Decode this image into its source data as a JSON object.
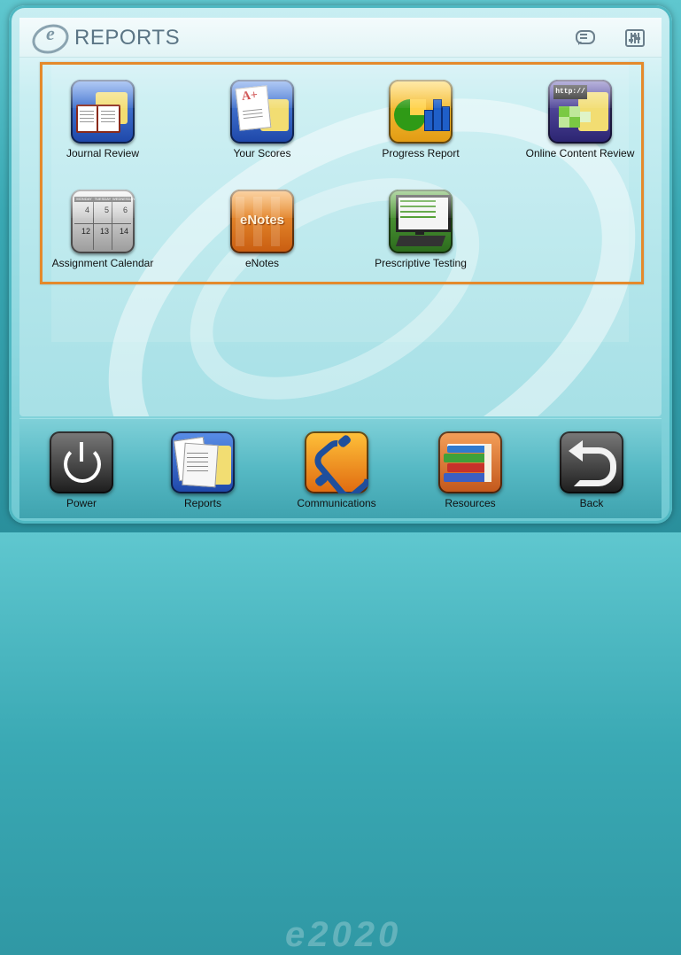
{
  "header": {
    "logo_letter": "e",
    "title": "REPORTS",
    "chat_icon": "chat-bubble-icon",
    "settings_icon": "settings-sliders-icon"
  },
  "reports": [
    {
      "label": "Journal Review",
      "icon": "journal-book-folder-icon",
      "color": "#2b5fc1"
    },
    {
      "label": "Your Scores",
      "icon": "graded-paper-folder-icon",
      "color": "#2e63c4"
    },
    {
      "label": "Progress Report",
      "icon": "pie-bar-chart-icon",
      "color": "#e6a51a"
    },
    {
      "label": "Online Content Review",
      "icon": "web-puzzle-folder-icon",
      "color": "#4a3d8f"
    },
    {
      "label": "Assignment Calendar",
      "icon": "calendar-icon",
      "color": "#6a6a6a"
    },
    {
      "label": "eNotes",
      "icon": "enotes-icon",
      "color": "#e0781e"
    },
    {
      "label": "Prescriptive Testing",
      "icon": "computer-checklist-icon",
      "color": "#3c7a2b"
    }
  ],
  "calendar": {
    "days": [
      "MONDAY",
      "TUESDAY",
      "WEDNESDAY"
    ],
    "row1": [
      "4",
      "5",
      "6"
    ],
    "row2": [
      "12",
      "13",
      "14"
    ]
  },
  "dock": [
    {
      "label": "Power",
      "icon": "power-icon"
    },
    {
      "label": "Reports",
      "icon": "reports-folder-icon"
    },
    {
      "label": "Communications",
      "icon": "telephone-icon"
    },
    {
      "label": "Resources",
      "icon": "books-icon"
    },
    {
      "label": "Back",
      "icon": "back-arrow-icon"
    }
  ],
  "colors": {
    "highlight_border": "#e48a2c",
    "header_text": "#5b7585"
  }
}
